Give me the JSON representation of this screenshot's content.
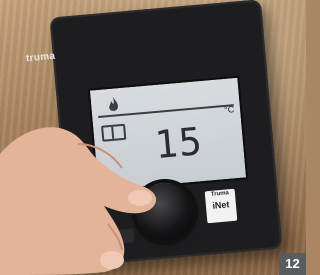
{
  "device": {
    "brand": "truma",
    "temperature": "15",
    "unit": "°C",
    "badge_brand": "Truma",
    "badge_text": "iNet"
  },
  "corner_label": "12"
}
